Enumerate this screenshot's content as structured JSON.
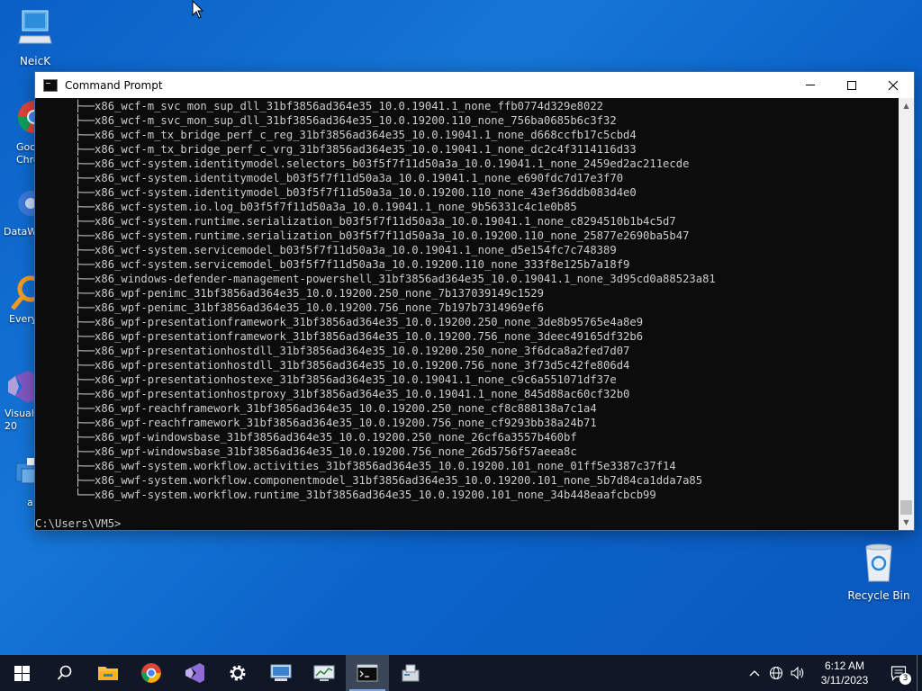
{
  "desktop": {
    "icons": [
      {
        "label": "NeicK"
      },
      {
        "label": "Goo Chro"
      },
      {
        "label": "DataW"
      },
      {
        "label": "Every"
      },
      {
        "label": "Visual 20"
      },
      {
        "label": "a"
      },
      {
        "label": "Recycle Bin"
      }
    ]
  },
  "window": {
    "title": "Command Prompt",
    "lines": [
      "      ├──x86_wcf-m_svc_mon_sup_dll_31bf3856ad364e35_10.0.19041.1_none_ffb0774d329e8022",
      "      ├──x86_wcf-m_svc_mon_sup_dll_31bf3856ad364e35_10.0.19200.110_none_756ba0685b6c3f32",
      "      ├──x86_wcf-m_tx_bridge_perf_c_reg_31bf3856ad364e35_10.0.19041.1_none_d668ccfb17c5cbd4",
      "      ├──x86_wcf-m_tx_bridge_perf_c_vrg_31bf3856ad364e35_10.0.19041.1_none_dc2c4f3114116d33",
      "      ├──x86_wcf-system.identitymodel.selectors_b03f5f7f11d50a3a_10.0.19041.1_none_2459ed2ac211ecde",
      "      ├──x86_wcf-system.identitymodel_b03f5f7f11d50a3a_10.0.19041.1_none_e690fdc7d17e3f70",
      "      ├──x86_wcf-system.identitymodel_b03f5f7f11d50a3a_10.0.19200.110_none_43ef36ddb083d4e0",
      "      ├──x86_wcf-system.io.log_b03f5f7f11d50a3a_10.0.19041.1_none_9b56331c4c1e0b85",
      "      ├──x86_wcf-system.runtime.serialization_b03f5f7f11d50a3a_10.0.19041.1_none_c8294510b1b4c5d7",
      "      ├──x86_wcf-system.runtime.serialization_b03f5f7f11d50a3a_10.0.19200.110_none_25877e2690ba5b47",
      "      ├──x86_wcf-system.servicemodel_b03f5f7f11d50a3a_10.0.19041.1_none_d5e154fc7c748389",
      "      ├──x86_wcf-system.servicemodel_b03f5f7f11d50a3a_10.0.19200.110_none_333f8e125b7a18f9",
      "      ├──x86_windows-defender-management-powershell_31bf3856ad364e35_10.0.19041.1_none_3d95cd0a88523a81",
      "      ├──x86_wpf-penimc_31bf3856ad364e35_10.0.19200.250_none_7b137039149c1529",
      "      ├──x86_wpf-penimc_31bf3856ad364e35_10.0.19200.756_none_7b197b7314969ef6",
      "      ├──x86_wpf-presentationframework_31bf3856ad364e35_10.0.19200.250_none_3de8b95765e4a8e9",
      "      ├──x86_wpf-presentationframework_31bf3856ad364e35_10.0.19200.756_none_3deec49165df32b6",
      "      ├──x86_wpf-presentationhostdll_31bf3856ad364e35_10.0.19200.250_none_3f6dca8a2fed7d07",
      "      ├──x86_wpf-presentationhostdll_31bf3856ad364e35_10.0.19200.756_none_3f73d5c42fe806d4",
      "      ├──x86_wpf-presentationhostexe_31bf3856ad364e35_10.0.19041.1_none_c9c6a551071df37e",
      "      ├──x86_wpf-presentationhostproxy_31bf3856ad364e35_10.0.19041.1_none_845d88ac60cf32b0",
      "      ├──x86_wpf-reachframework_31bf3856ad364e35_10.0.19200.250_none_cf8c888138a7c1a4",
      "      ├──x86_wpf-reachframework_31bf3856ad364e35_10.0.19200.756_none_cf9293bb38a24b71",
      "      ├──x86_wpf-windowsbase_31bf3856ad364e35_10.0.19200.250_none_26cf6a3557b460bf",
      "      ├──x86_wpf-windowsbase_31bf3856ad364e35_10.0.19200.756_none_26d5756f57aeea8c",
      "      ├──x86_wwf-system.workflow.activities_31bf3856ad364e35_10.0.19200.101_none_01ff5e3387c37f14",
      "      ├──x86_wwf-system.workflow.componentmodel_31bf3856ad364e35_10.0.19200.101_none_5b7d84ca1dda7a85",
      "      └──x86_wwf-system.workflow.runtime_31bf3856ad364e35_10.0.19200.101_none_34b448eaafcbcb99",
      "",
      "C:\\Users\\VM5>"
    ]
  },
  "taskbar": {
    "clock_time": "6:12 AM",
    "clock_date": "3/11/2023",
    "notification_count": "3"
  }
}
